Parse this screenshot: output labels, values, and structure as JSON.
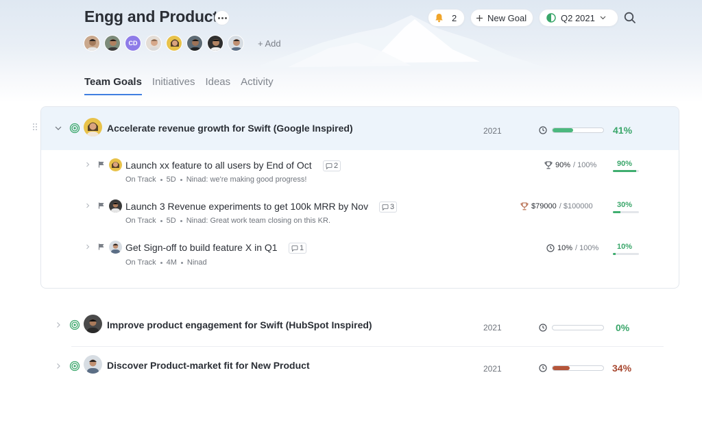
{
  "header": {
    "title": "Engg and Product",
    "notifications_count": "2",
    "new_goal_label": "New Goal",
    "period_label": "Q2 2021",
    "add_people_label": "+ Add",
    "initials_avatar": "CD"
  },
  "tabs": [
    {
      "label": "Team Goals",
      "active": true
    },
    {
      "label": "Initiatives",
      "active": false
    },
    {
      "label": "Ideas",
      "active": false
    },
    {
      "label": "Activity",
      "active": false
    }
  ],
  "goals": [
    {
      "title": "Accelerate revenue growth for Swift (Google Inspired)",
      "year": "2021",
      "progress_pct": "41%",
      "progress_value": 0.41,
      "progress_color": "#4cb87e",
      "pct_color": "#3aa66a",
      "expanded": true,
      "key_results": [
        {
          "title": "Launch xx feature to all users by End of Oct",
          "comments": "2",
          "status": "On Track",
          "age": "5D",
          "note": "Ninad: we're making good progress!",
          "metric_icon": "trophy-icon",
          "current": "90%",
          "target": "/ 100%",
          "pct": "90%",
          "progress_value": 0.9
        },
        {
          "title": "Launch 3 Revenue experiments to get 100k MRR by Nov",
          "comments": "3",
          "status": "On Track",
          "age": "5D",
          "note": "Ninad: Great work team closing on this KR.",
          "metric_icon": "trophy-icon",
          "current": "$79000",
          "target": "/ $100000",
          "pct": "30%",
          "progress_value": 0.3
        },
        {
          "title": "Get Sign-off to build feature X in Q1",
          "comments": "1",
          "status": "On Track",
          "age": "4M",
          "note": "Ninad",
          "metric_icon": "clock-icon",
          "current": "10%",
          "target": "/ 100%",
          "pct": "10%",
          "progress_value": 0.1
        }
      ]
    },
    {
      "title": "Improve product engagement for Swift (HubSpot Inspired)",
      "year": "2021",
      "progress_pct": "0%",
      "progress_value": 0,
      "progress_color": "#4cb87e",
      "pct_color": "#3aa66a",
      "expanded": false
    },
    {
      "title": "Discover Product-market fit for New Product",
      "year": "2021",
      "progress_pct": "34%",
      "progress_value": 0.34,
      "progress_color": "#b5553a",
      "pct_color": "#a7472f",
      "expanded": false
    }
  ],
  "colors": {
    "accent": "#3f7fe0",
    "on_track_green": "#3aa66a",
    "at_risk_red": "#a7472f",
    "notification_bell": "#f0a52a"
  }
}
